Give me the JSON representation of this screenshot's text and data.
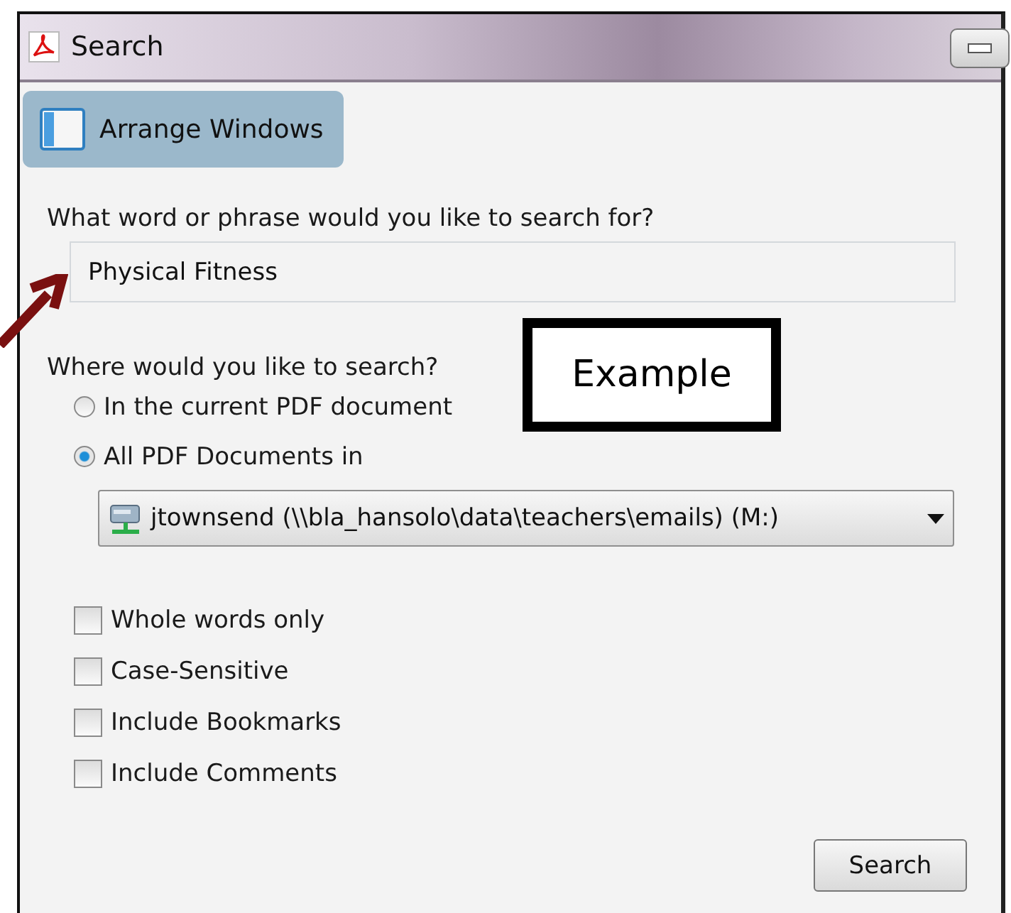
{
  "window": {
    "title": "Search"
  },
  "toolbar": {
    "arrange_button": "Arrange Windows"
  },
  "search_field": {
    "label": "What word or phrase would you like to search for?",
    "value": "Physical Fitness"
  },
  "location": {
    "label": "Where would you like to search?",
    "options": [
      {
        "label": "In the current PDF document",
        "selected": false
      },
      {
        "label": "All PDF Documents in",
        "selected": true
      }
    ],
    "dropdown": {
      "value": "jtownsend (\\\\bla_hansolo\\data\\teachers\\emails) (M:)"
    }
  },
  "options": [
    {
      "label": "Whole words only",
      "checked": false
    },
    {
      "label": "Case-Sensitive",
      "checked": false
    },
    {
      "label": "Include Bookmarks",
      "checked": false
    },
    {
      "label": "Include Comments",
      "checked": false
    }
  ],
  "search_button": "Search",
  "annotation": {
    "callout": "Example"
  }
}
